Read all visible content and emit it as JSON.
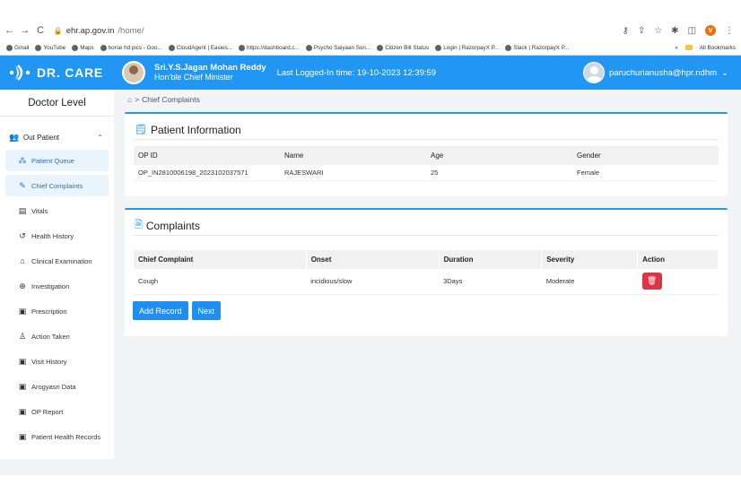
{
  "browser": {
    "url_host": "ehr.ap.gov.in",
    "url_path": "/home/",
    "bookmarks": [
      "Gmail",
      "YouTube",
      "Maps",
      "horse hd pics - Goo...",
      "CloudAgent | Easies...",
      "https://dashboard.c...",
      "Psycho Saiyaan Son...",
      "Citizen Bill Status",
      "Login | RazorpayX P...",
      "Slack | RazorpayX P..."
    ],
    "all_bookmarks": "All Bookmarks",
    "more": "»",
    "profile_initial": "V"
  },
  "header": {
    "brand": "DR. CARE",
    "cm_name": "Sri.Y.S.Jagan Mohan Reddy",
    "cm_title": "Hon'ble Chief Minister",
    "last_login": "Last Logged-In time: 19-10-2023 12:39:59",
    "user": "paruchurianusha@hpr.ndhm",
    "brand_color": "#2196f3"
  },
  "sidebar": {
    "title": "Doctor Level",
    "group": "Out Patient",
    "items": [
      {
        "label": "Patient Queue",
        "icon": "users-icon"
      },
      {
        "label": "Chief Complaints",
        "icon": "edit-icon"
      },
      {
        "label": "Vitals",
        "icon": "vitals-icon"
      },
      {
        "label": "Health History",
        "icon": "history-icon"
      },
      {
        "label": "Clinical Examination",
        "icon": "home-check-icon"
      },
      {
        "label": "Investigation",
        "icon": "zoom-icon"
      },
      {
        "label": "Prescription",
        "icon": "clipboard-icon"
      },
      {
        "label": "Action Taken",
        "icon": "person-icon"
      },
      {
        "label": "Visit History",
        "icon": "clipboard-icon"
      },
      {
        "label": "Arogyasri Data",
        "icon": "clipboard-icon"
      },
      {
        "label": "OP Report",
        "icon": "clipboard-icon"
      },
      {
        "label": "Patient Health Records",
        "icon": "clipboard-icon"
      }
    ]
  },
  "breadcrumb": {
    "current": "Chief Complaints"
  },
  "patient_info": {
    "title": "Patient Information",
    "columns": [
      "OP ID",
      "Name",
      "Age",
      "Gender"
    ],
    "row": [
      "OP_IN2810006198_2023102037571",
      "RAJESWARI",
      "25",
      "Female"
    ]
  },
  "complaints": {
    "title": "Complaints",
    "columns": [
      "Chief Complaint",
      "Onset",
      "Duration",
      "Severity",
      "Action"
    ],
    "row": [
      "Cough",
      "incidious/slow",
      "3Days",
      "Moderate"
    ],
    "add_label": "Add Record",
    "next_label": "Next"
  }
}
